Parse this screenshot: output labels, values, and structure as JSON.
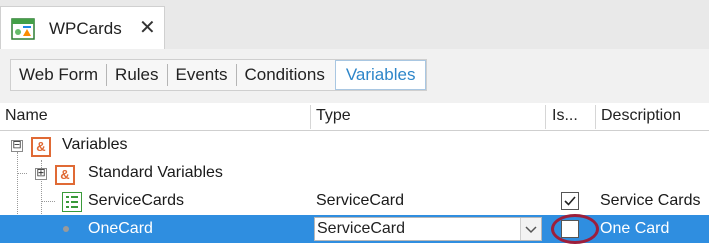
{
  "document_tab": {
    "title": "WPCards",
    "close_glyph": "✕",
    "icon": "web-panel-icon"
  },
  "part_tabs": [
    {
      "label": "Web Form",
      "active": false
    },
    {
      "label": "Rules",
      "active": false
    },
    {
      "label": "Events",
      "active": false
    },
    {
      "label": "Conditions",
      "active": false
    },
    {
      "label": "Variables",
      "active": true
    }
  ],
  "grid": {
    "columns": [
      "Name",
      "Type",
      "Is...",
      "Description"
    ],
    "rows": [
      {
        "name": "Variables",
        "type": "",
        "is_collection": null,
        "description": "",
        "expander": "⊟",
        "icon": "ampersand-icon"
      },
      {
        "name": "Standard Variables",
        "type": "",
        "is_collection": null,
        "description": "",
        "expander": "⊞",
        "icon": "ampersand-icon"
      },
      {
        "name": "ServiceCards",
        "type": "ServiceCard",
        "is_collection": true,
        "description": "Service Cards",
        "icon": "sdt-icon"
      },
      {
        "name": "OneCard",
        "type": "ServiceCard",
        "is_collection": false,
        "description": "One Card",
        "icon": "bullet-icon",
        "selected": true
      }
    ]
  },
  "colors": {
    "selection": "#2f8ee0",
    "active_tab_text": "#2e86c9",
    "ampersand_icon": "#e06a35",
    "highlight_ring": "#9c1f3c"
  }
}
